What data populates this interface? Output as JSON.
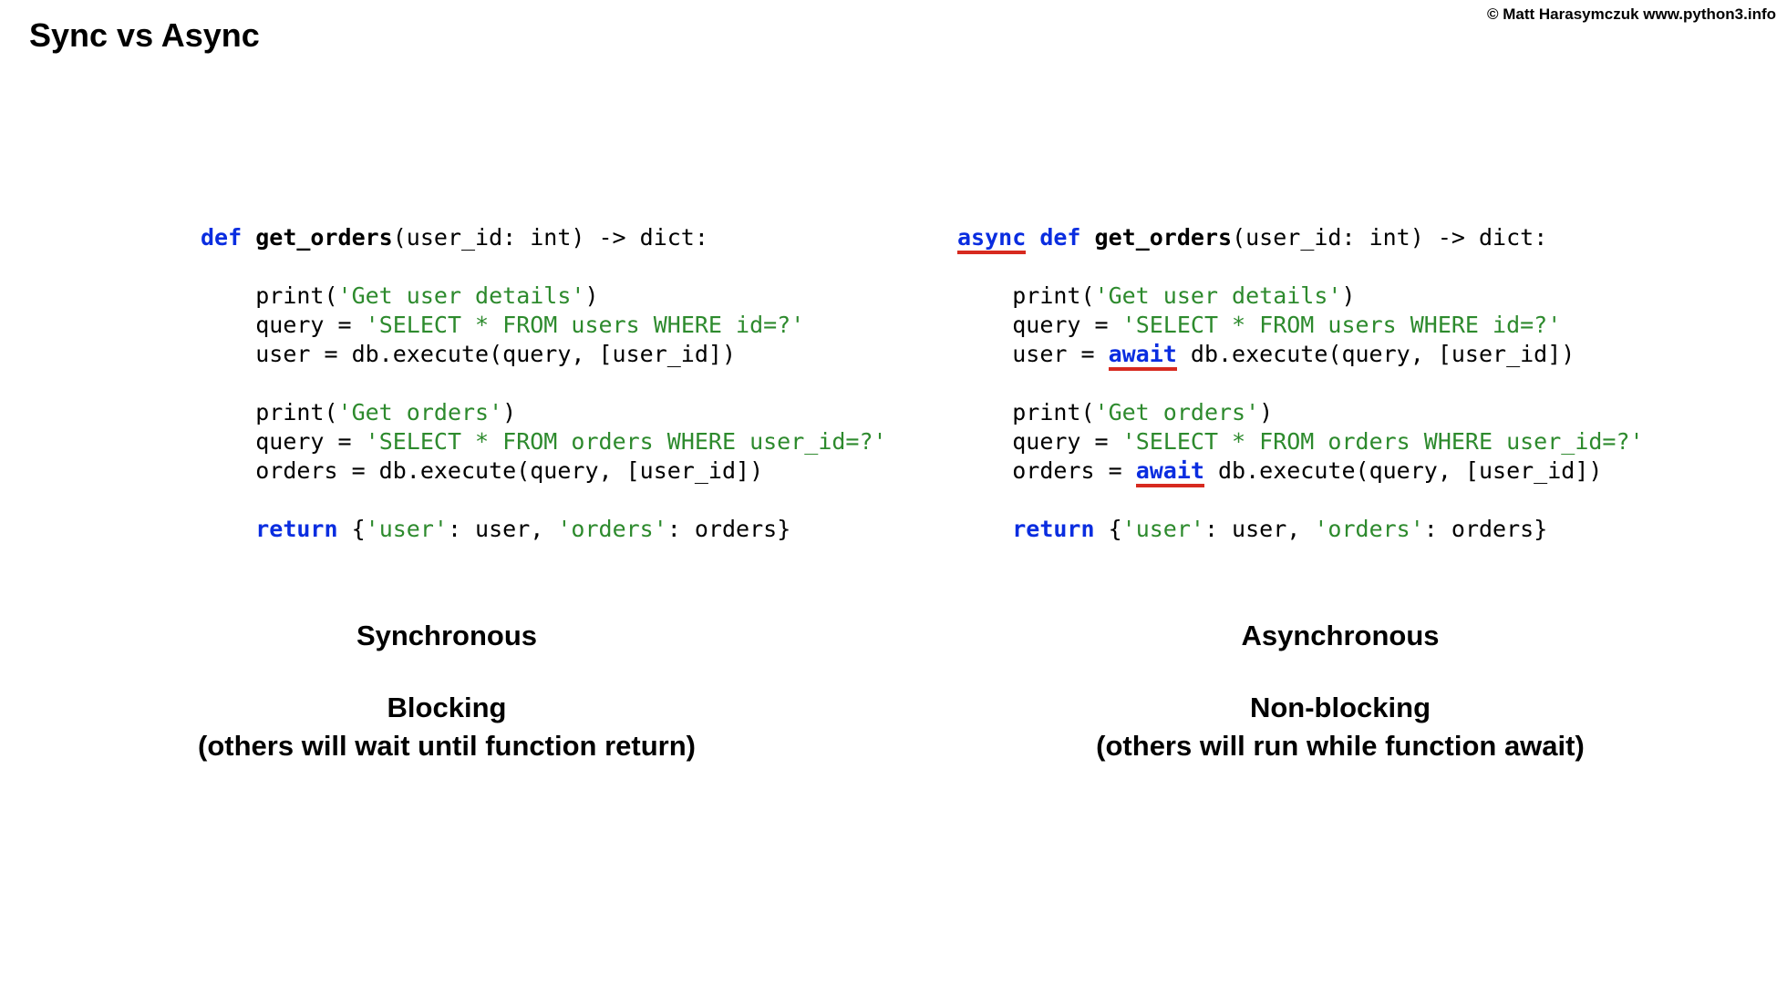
{
  "title": "Sync vs Async",
  "copyright": "© Matt Harasymczuk www.python3.info",
  "code": {
    "kw_def": "def",
    "kw_async": "async",
    "kw_await": "await",
    "kw_return": "return",
    "fn_name": "get_orders",
    "sig_tail": "(user_id: int) -> dict:",
    "print_open": "print(",
    "str_get_user": "'Get user details'",
    "str_get_orders": "'Get orders'",
    "close_paren": ")",
    "q_assign": "query = ",
    "str_q_users": "'SELECT * FROM users WHERE id=?'",
    "str_q_orders": "'SELECT * FROM orders WHERE user_id=?'",
    "user_assign": "user = db.execute(query, [user_id])",
    "user_assign_head": "user = ",
    "db_exec_tail": " db.execute(query, [user_id])",
    "orders_assign": "orders = db.execute(query, [user_id])",
    "orders_assign_head": "orders = ",
    "ret_body_open": " {",
    "str_user_key": "'user'",
    "colon_user": ": user, ",
    "str_orders_key": "'orders'",
    "colon_orders": ": orders}"
  },
  "labels": {
    "left": {
      "heading": "Synchronous",
      "sub1": "Blocking",
      "sub2": "(others will wait until function return)"
    },
    "right": {
      "heading": "Asynchronous",
      "sub1": "Non-blocking",
      "sub2": "(others will run while function await)"
    }
  }
}
